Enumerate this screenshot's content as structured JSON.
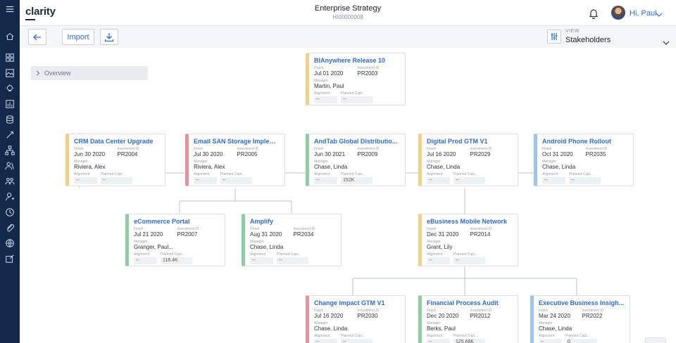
{
  "header": {
    "logo": "clarity",
    "title": "Enterprise Strategy",
    "subtitle": "HI00000008",
    "greeting": "Hi, Paul"
  },
  "toolbar": {
    "import_label": "Import",
    "view_label": "VIEW",
    "view_value": "Stakeholders"
  },
  "overview_label": "Overview",
  "labels": {
    "finish": "Finish",
    "investment_id": "Investment ID",
    "manager": "Manager",
    "alignment": "Alignment",
    "planned_capital": "Planned Capi..."
  },
  "colors": {
    "yellow": "#f5cf82",
    "pink": "#e8919b",
    "green": "#8ad0a0",
    "blue": "#9cc6ec",
    "accent": "#2f6bd6",
    "nav": "#13294b"
  },
  "nav_icons": [
    "menu-icon",
    "home-icon",
    "grid-icon",
    "image-icon",
    "idea-icon",
    "chart-icon",
    "stack-icon",
    "link-icon",
    "org-icon",
    "people-icon",
    "team-icon",
    "user-icon",
    "clock-icon",
    "attachment-icon",
    "globe-icon",
    "edit-icon"
  ],
  "cards": {
    "root": {
      "title": "BIAnywhere Release 10",
      "finish": "Jul 01 2020",
      "investment_id": "PR2003",
      "manager": "Martin, Paul",
      "alignment": "--",
      "planned_capital": "--",
      "color": "yellow"
    },
    "crm": {
      "title": "CRM Data Center Upgrade",
      "finish": "Jun 30 2020",
      "investment_id": "PR2004",
      "manager": "Riviera, Alex",
      "alignment": "--",
      "planned_capital": "--",
      "color": "yellow"
    },
    "email": {
      "title": "Email SAN Storage Impleme...",
      "finish": "Jul 30 2020",
      "investment_id": "PR2005",
      "manager": "Riviera, Alex",
      "alignment": "--",
      "planned_capital": "--",
      "color": "pink"
    },
    "andtab": {
      "title": "AndTab Global Distributio...",
      "finish": "Jun 30 2021",
      "investment_id": "PR2009",
      "manager": "Chase, Linda",
      "alignment": "--",
      "planned_capital": "152K",
      "color": "green"
    },
    "digital": {
      "title": "Digital Prod GTM V1",
      "finish": "Jul 16 2020",
      "investment_id": "PR2029",
      "manager": "Chase, Linda",
      "alignment": "--",
      "planned_capital": "--",
      "color": "yellow"
    },
    "android": {
      "title": "Android Phone Rollout",
      "finish": "Oct 31 2020",
      "investment_id": "PR2035",
      "manager": "Chase, Linda",
      "alignment": "--",
      "planned_capital": "--",
      "color": "blue"
    },
    "ecommerce": {
      "title": "eCommerce Portal",
      "finish": "Jul 21 2020",
      "investment_id": "PR2007",
      "manager": "Granger, Paul...",
      "alignment": "--",
      "planned_capital": "118.4K",
      "color": "green"
    },
    "amplify": {
      "title": "Amplify",
      "finish": "Aug 31 2020",
      "investment_id": "PR2034",
      "manager": "Chase, Linda",
      "alignment": "--",
      "planned_capital": "--",
      "color": "green"
    },
    "ebusiness": {
      "title": "eBusiness Mobile Network",
      "finish": "Dec 31 2020",
      "investment_id": "PR2014",
      "manager": "Grant, Lily",
      "alignment": "--",
      "planned_capital": "--",
      "color": "yellow"
    },
    "change": {
      "title": "Change Impact GTM V1",
      "finish": "Jul 16 2020",
      "investment_id": "PR2030",
      "manager": "Chase, Linda",
      "alignment": "--",
      "planned_capital": "--",
      "color": "pink"
    },
    "financial": {
      "title": "Financial Process Audit",
      "finish": "Dec 20 2020",
      "investment_id": "PR2012",
      "manager": "Berks, Paul",
      "alignment": "--",
      "planned_capital": "125.68K",
      "color": "green"
    },
    "executive": {
      "title": "Executive Business Insigh...",
      "finish": "Mar 24 2020",
      "investment_id": "PR2022",
      "manager": "Chase, Linda",
      "alignment": "--",
      "planned_capital": "0",
      "color": "blue"
    }
  }
}
